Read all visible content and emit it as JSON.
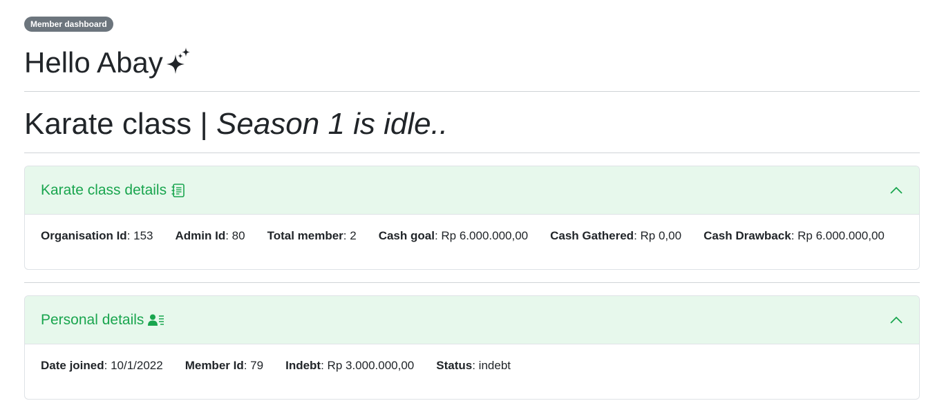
{
  "badge": "Member dashboard",
  "greeting": "Hello Abay",
  "class_title": {
    "name": "Karate class |",
    "status": "Season 1 is idle.."
  },
  "class_details": {
    "title": "Karate class details",
    "fields": [
      {
        "label": "Organisation Id",
        "value": ": 153"
      },
      {
        "label": "Admin Id",
        "value": ": 80"
      },
      {
        "label": "Total member",
        "value": ": 2"
      },
      {
        "label": "Cash goal",
        "value": ": Rp 6.000.000,00"
      },
      {
        "label": "Cash Gathered",
        "value": ": Rp 0,00"
      },
      {
        "label": "Cash Drawback",
        "value": ": Rp 6.000.000,00"
      }
    ]
  },
  "personal_details": {
    "title": "Personal details",
    "fields": [
      {
        "label": "Date joined",
        "value": ": 10/1/2022"
      },
      {
        "label": "Member Id",
        "value": ": 79"
      },
      {
        "label": "Indebt",
        "value": ": Rp 3.000.000,00"
      },
      {
        "label": "Status",
        "value": ": indebt"
      }
    ]
  },
  "colors": {
    "accent": "#19a54e",
    "header_bg": "#e7f8ec",
    "badge_bg": "#6c757d"
  },
  "icons": {
    "greeting": "sparkles-icon",
    "class_details": "journal-text-icon",
    "personal_details": "person-lines-icon",
    "collapse": "chevron-up-icon"
  }
}
